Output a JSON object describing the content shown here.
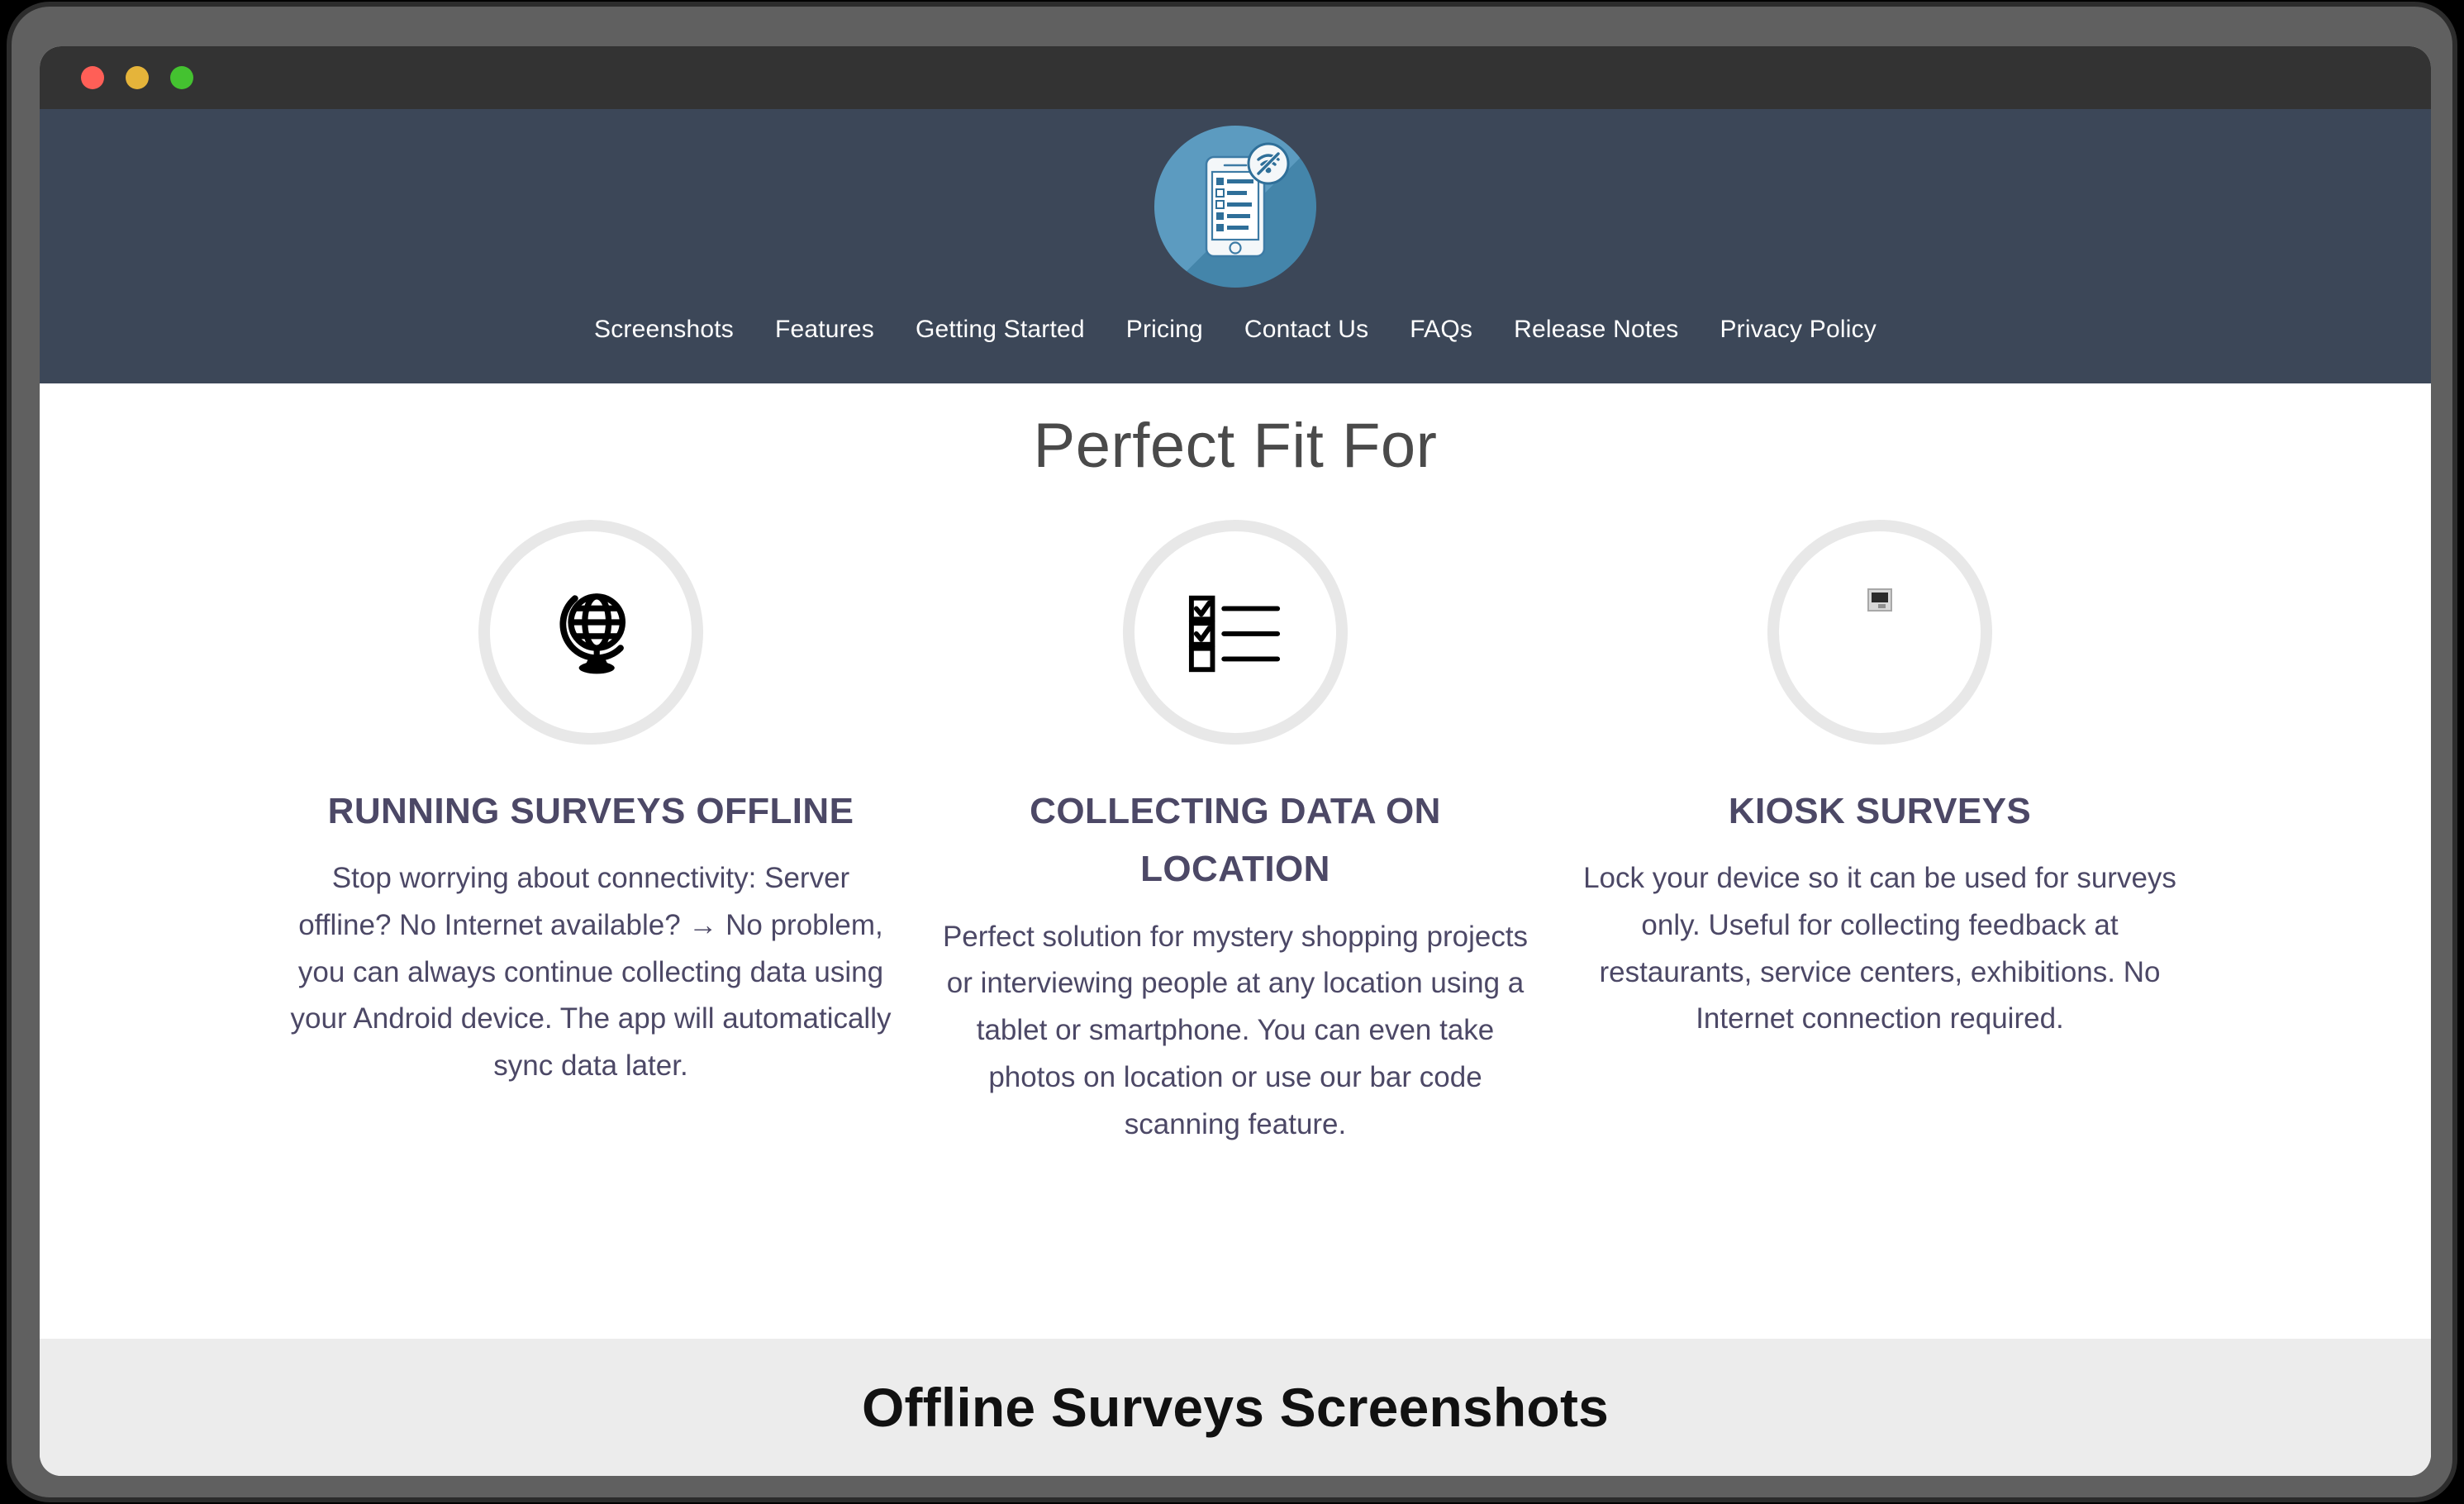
{
  "window": {
    "traffic_lights": [
      {
        "name": "close",
        "color": "#ff5f57"
      },
      {
        "name": "minimize",
        "color": "#e5b43a"
      },
      {
        "name": "maximize",
        "color": "#44c230"
      }
    ]
  },
  "header": {
    "background_color": "#3c4758",
    "logo": {
      "icon": "offline-survey-tablet-logo",
      "circle_color": "#4a90b9",
      "badge_icon": "wifi-off-icon"
    },
    "nav": [
      {
        "label": "Screenshots"
      },
      {
        "label": "Features"
      },
      {
        "label": "Getting Started"
      },
      {
        "label": "Pricing"
      },
      {
        "label": "Contact Us"
      },
      {
        "label": "FAQs"
      },
      {
        "label": "Release Notes"
      },
      {
        "label": "Privacy Policy"
      }
    ]
  },
  "main": {
    "title": "Perfect Fit For",
    "title_color": "#4a4a4a",
    "cards": [
      {
        "icon": "globe-stand-icon",
        "title": "RUNNING SURVEYS OFFLINE",
        "body": "Stop worrying about connectivity: Server offline? No Internet available? → No problem, you can always continue collecting data using your Android device. The app will automatically sync data later."
      },
      {
        "icon": "checklist-icon",
        "title": "COLLECTING DATA ON LOCATION",
        "body": "Perfect solution for mystery shopping projects or interviewing people at any location using a tablet or smartphone. You can even take photos on location or use our bar code scanning feature."
      },
      {
        "icon": "broken-image-placeholder-icon",
        "title": "KIOSK SURVEYS",
        "body": "Lock your device so it can be used for surveys only. Useful for collecting feedback at restaurants, service centers, exhibitions. No Internet connection required."
      }
    ],
    "heading_color": "#4c4866"
  },
  "footer": {
    "title": "Offline Surveys Screenshots",
    "background_color": "#ececec"
  }
}
